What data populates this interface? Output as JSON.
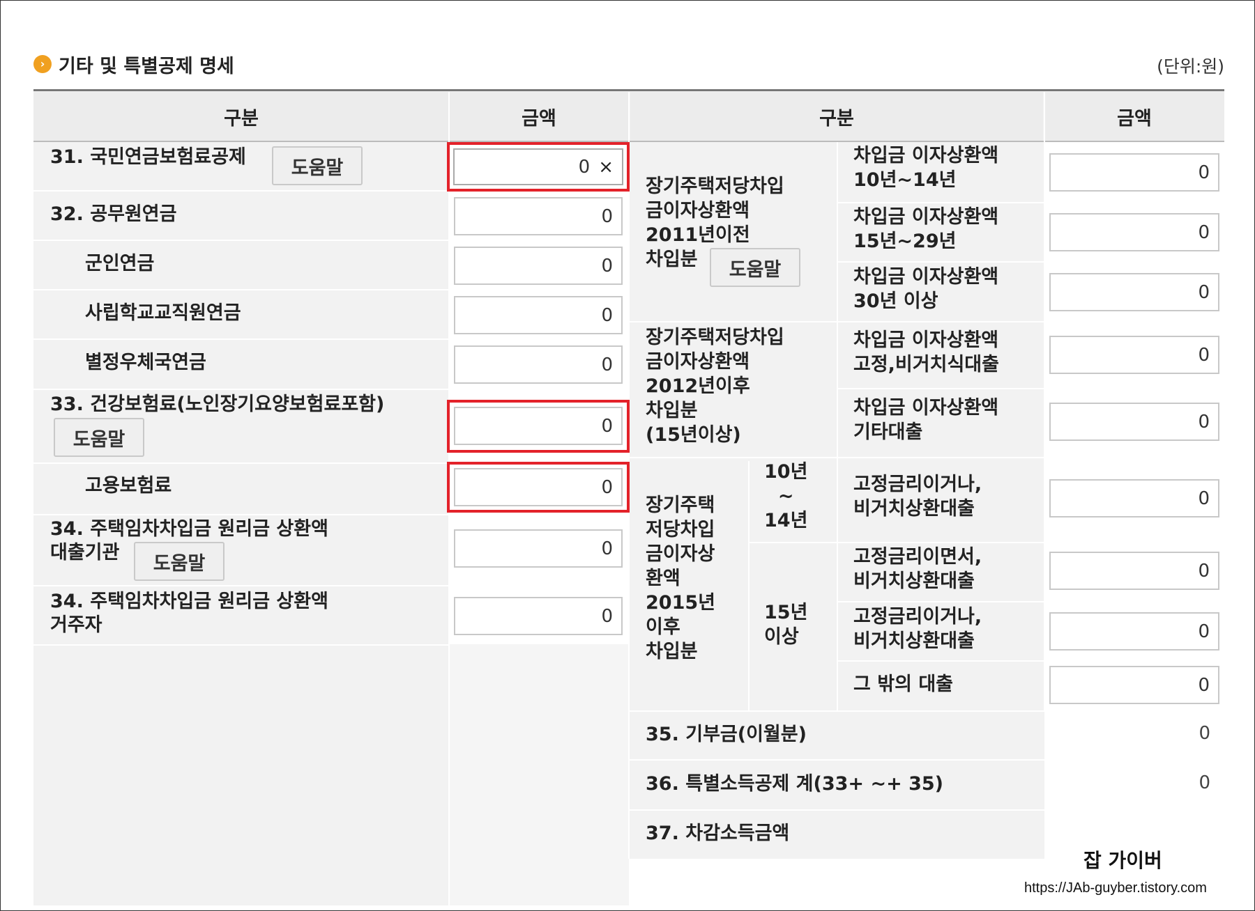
{
  "title": "기타 및 특별공제 명세",
  "unit": "(단위:원)",
  "headers": {
    "left_category": "구분",
    "left_amount": "금액",
    "right_category": "구분",
    "right_amount": "금액"
  },
  "help_label": "도움말",
  "left_rows": [
    {
      "label": "31. 국민연금보험료공제",
      "value": "0",
      "clear": "×"
    },
    {
      "label": "32. 공무원연금",
      "value": "0"
    },
    {
      "label": "군인연금",
      "value": "0"
    },
    {
      "label": "사립학교교직원연금",
      "value": "0"
    },
    {
      "label": "별정우체국연금",
      "value": "0"
    },
    {
      "label": "33. 건강보험료(노인장기요양보험료포함)",
      "value": "0"
    },
    {
      "label": "고용보험료",
      "value": "0"
    },
    {
      "label_1": "34. 주택임차차입금 원리금 상환액",
      "label_2": "대출기관",
      "value": "0"
    },
    {
      "label_1": "34. 주택임차차입금 원리금 상환액",
      "label_2": "거주자",
      "value": "0"
    }
  ],
  "right_groups": {
    "g1": {
      "lines": [
        "장기주택저당차입",
        "금이자상환액",
        "2011년이전",
        "차입분"
      ]
    },
    "g2": {
      "lines": [
        "장기주택저당차입",
        "금이자상환액",
        "2012년이후",
        "차입분",
        "(15년이상)"
      ]
    },
    "g3": {
      "lines": [
        "장기주택",
        "저당차입",
        "금이자상",
        "환액",
        "2015년",
        "이후",
        "차입분"
      ],
      "sub1": [
        "10년",
        "~",
        "14년"
      ],
      "sub2": [
        "15년",
        "이상"
      ]
    }
  },
  "right_rows": [
    {
      "line1": "차입금 이자상환액",
      "line2": "10년~14년",
      "value": "0"
    },
    {
      "line1": "차입금 이자상환액",
      "line2": "15년~29년",
      "value": "0"
    },
    {
      "line1": "차입금 이자상환액",
      "line2": "30년 이상",
      "value": "0"
    },
    {
      "line1": "차입금 이자상환액",
      "line2": "고정,비거치식대출",
      "value": "0"
    },
    {
      "line1": "차입금 이자상환액",
      "line2": "기타대출",
      "value": "0"
    },
    {
      "line1": "고정금리이거나,",
      "line2": "비거치상환대출",
      "value": "0"
    },
    {
      "line1": "고정금리이면서,",
      "line2": "비거치상환대출",
      "value": "0"
    },
    {
      "line1": "고정금리이거나,",
      "line2": "비거치상환대출",
      "value": "0"
    },
    {
      "line1": "그 밖의 대출",
      "line2": "",
      "value": "0"
    }
  ],
  "bottom_rows": [
    {
      "label": "35. 기부금(이월분)",
      "value": "0"
    },
    {
      "label": "36. 특별소득공제 계(33+ ~+ 35)",
      "value": "0"
    },
    {
      "label": "37. 차감소득금액",
      "value": ""
    }
  ],
  "watermark": {
    "name": "잡 가이버",
    "url": "https://JAb-guyber.tistory.com"
  },
  "colors": {
    "highlight": "#e3222a",
    "bullet": "#f0a020",
    "header_bg": "#ececec",
    "row_bg": "#f2f2f2"
  }
}
